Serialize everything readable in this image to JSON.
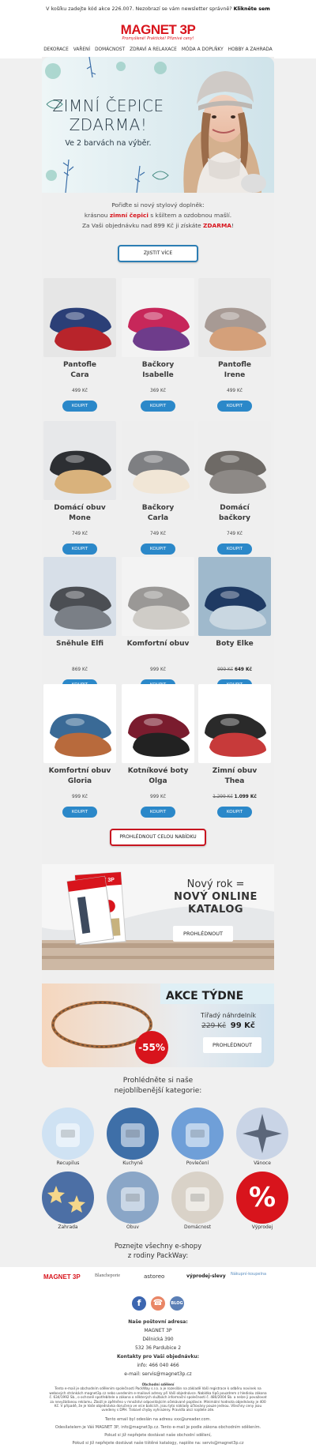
{
  "topbar": {
    "text": "V košíku zadejte kód akce 226.007. Nezobrazí se vám newsletter správně?",
    "link": "Klikněte sem"
  },
  "brand": {
    "logo": "MAGNET 3P",
    "tagline": "Promyšlené! Praktické! Příznivé ceny!",
    "color": "#d8141c"
  },
  "nav": [
    "DEKORACE",
    "VAŘENÍ",
    "DOMÁCNOST",
    "ZDRAVÍ A RELAXACE",
    "MÓDA A DOPLŇKY",
    "HOBBY A ZAHRADA"
  ],
  "hero": {
    "title_line1": "ZIMNÍ ČEPICE",
    "title_line2": "ZDARMA!",
    "subtitle": "Ve 2 barvách na výběr."
  },
  "intro": {
    "line1": "Pořiďte si nový stylový doplněk:",
    "line2_pre": "krásnou ",
    "line2_red": "zimní čepici",
    "line2_post": " s kšiltem a ozdobnou mašlí.",
    "line3_pre": "Za Vaši objednávku nad 899 Kč ji získáte ",
    "line3_red": "ZDARMA",
    "line3_post": "!"
  },
  "cta_more": "ZJISTIT VÍCE",
  "buy_label": "KOUPIT",
  "products": [
    {
      "name1": "Pantofle",
      "name2": "Cara",
      "price": "499 Kč",
      "old": "",
      "icon": "slipper-icon"
    },
    {
      "name1": "Bačkory",
      "name2": "Isabelle",
      "price": "369 Kč",
      "old": "",
      "icon": "slipper-icon"
    },
    {
      "name1": "Pantofle",
      "name2": "Irene",
      "price": "499 Kč",
      "old": "",
      "icon": "slipper-icon"
    },
    {
      "name1": "Domácí obuv",
      "name2": "Mone",
      "price": "749 Kč",
      "old": "",
      "icon": "shoe-icon"
    },
    {
      "name1": "Bačkory",
      "name2": "Carla",
      "price": "749 Kč",
      "old": "",
      "icon": "shoe-icon"
    },
    {
      "name1": "Domácí",
      "name2": "bačkory",
      "price": "749 Kč",
      "old": "",
      "icon": "shoe-icon"
    },
    {
      "name1": "Sněhule Elfi",
      "name2": "",
      "price": "869 Kč",
      "old": "",
      "icon": "boot-icon"
    },
    {
      "name1": "Komfortní obuv",
      "name2": "",
      "price": "999 Kč",
      "old": "",
      "icon": "boot-icon"
    },
    {
      "name1": "Boty Elke",
      "name2": "",
      "price": "649 Kč",
      "old": "999 Kč",
      "icon": "boot-icon"
    },
    {
      "name1": "Komfortní obuv",
      "name2": "Gloria",
      "price": "999 Kč",
      "old": "",
      "icon": "boot-icon"
    },
    {
      "name1": "Kotníkové boty",
      "name2": "Olga",
      "price": "999 Kč",
      "old": "",
      "icon": "boot-icon"
    },
    {
      "name1": "Zimní obuv",
      "name2": "Thea",
      "price": "1.099 Kč",
      "old": "1.299 Kč",
      "icon": "boot-icon"
    }
  ],
  "cta_all": "PROHLÉDNOUT CELOU NABÍDKU",
  "catalog": {
    "line1": "Nový rok =",
    "line2": "NOVÝ ONLINE",
    "line3": "KATALOG",
    "button": "PROHLÉDNOUT"
  },
  "weekly": {
    "title": "AKCE TÝDNE",
    "product": "Tířadý náhrdelník",
    "old_price": "229 Kč",
    "price": "99 Kč",
    "discount": "-55%",
    "button": "PROHLÉDNOUT"
  },
  "categories_title_1": "Prohlédněte si naše",
  "categories_title_2": "nejoblíbenější kategorie:",
  "categories": [
    {
      "label": "Recupilus",
      "icon": "supplement-icon",
      "color": "#cfe2f3"
    },
    {
      "label": "Kuchyně",
      "icon": "kettle-icon",
      "color": "#3e6fa8"
    },
    {
      "label": "Povlečení",
      "icon": "bedding-icon",
      "color": "#6f9fd8"
    },
    {
      "label": "Vánoce",
      "icon": "star-icon",
      "color": "#c9d4e6"
    },
    {
      "label": "Zahrada",
      "icon": "lights-icon",
      "color": "#4c6fa5"
    },
    {
      "label": "Obuv",
      "icon": "shoe-icon",
      "color": "#8aa6c7"
    },
    {
      "label": "Domácnost",
      "icon": "slipper-icon",
      "color": "#d9d2c8"
    },
    {
      "label": "Výprodej",
      "icon": "percent-icon",
      "color": "#d8141c"
    }
  ],
  "eshops_title_1": "Poznejte všechny e-shopy",
  "eshops_title_2": "z rodiny PackWay:",
  "eshops": [
    "MAGNET 3P",
    "Blancheporte",
    "astoreo",
    "výprodej-slevy",
    "Nákupní-koupelna"
  ],
  "social": [
    "facebook-icon",
    "phone-icon",
    "blog-icon"
  ],
  "address": {
    "heading": "Naše poštovní adresa:",
    "line1": "MAGNET 3P",
    "line2": "Dělnická 390",
    "line3": "532 36 Pardubice 2",
    "contact_heading": "Kontakty pro Vaši objednávku:",
    "phone": "info: 466 040 466",
    "email": "e-mail: servis@magnet3p.cz"
  },
  "legal": {
    "heading": "Obchodní sdělení",
    "text": "Tento e-mail je obchodním sdělením společnosti PackWay s.r.o. a je rozesílán na základě Vaší registrace k odběru novinek na webových stránkách magnet3p.cz nebo uvedením e-mailové adresy při Vaší objednávce. Nabídka tipů pouzdrem z hledisku zákona č. 634/1992 Sb., o ochraně spotřebitele a zákona o některých službách informační společnosti č. 480/2004 Sb. a nelze ji považovat za nevyžádanou reklamu. Zboží je zpětněno v množství odpovídajícím očekávané poptávce. Minimální hodnota objednávky je 400 Kč. V případě, že je Vaše objednávka doručena ve více balících, jsou tyto náklady účtovány pouze jednou. Všechny ceny jsou uvedeny s DPH. Tiskové chyby vyhrazeny. Pravidla akcí najdete zde."
  },
  "bottom": {
    "line1": "Tento email byl odeslán na adresu xxx@ureader.com.",
    "line2": "Odesílatelem je Váš MAGNET 3P, info@magnet3p.cz. Tento e-mail je podle zákona obchodním sdělením.",
    "line3": "Pokud si již nepřejete dostávat naše obchodní sdělení,",
    "line4": "Pokud si již nepřejete dostávat naše tištěné katalogy, napište na: servis@magnet3p.cz"
  }
}
